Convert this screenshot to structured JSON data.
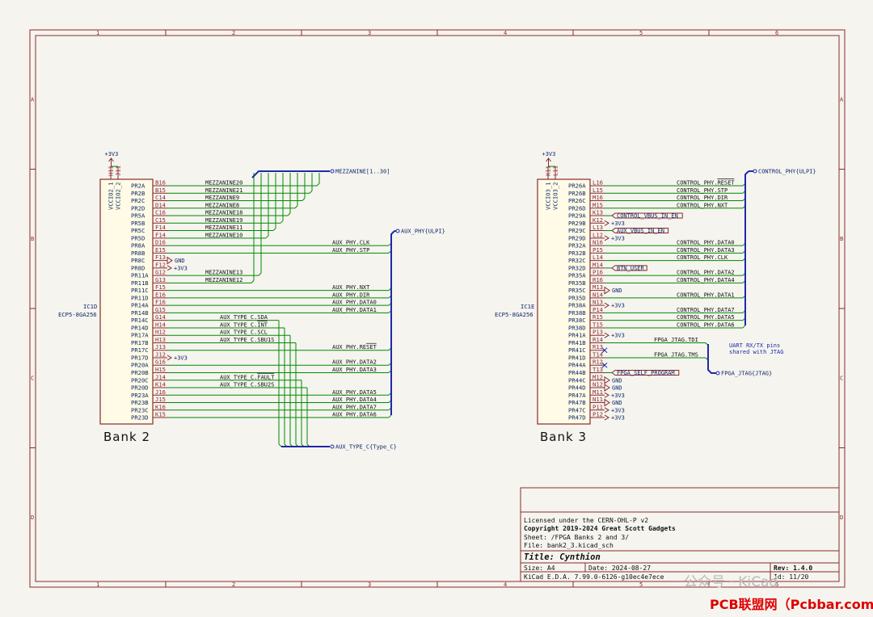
{
  "frame": {
    "columns": [
      "1",
      "2",
      "3",
      "4",
      "5",
      "6"
    ],
    "rows": [
      "A",
      "B",
      "C",
      "D"
    ]
  },
  "bank2": {
    "title": "Bank 2",
    "ref": "IC1D",
    "part": "ECP5-8GA256",
    "power_label": "+3V3",
    "top_pins": [
      {
        "num": "H11",
        "name": "VCCIO2_1"
      },
      {
        "num": "J11",
        "name": "VCCIO2_2"
      }
    ],
    "pins": [
      {
        "num": "B16",
        "name": "PR2A",
        "net": "MEZZANINE20",
        "kind": "mezz"
      },
      {
        "num": "B15",
        "name": "PR2B",
        "net": "MEZZANINE21",
        "kind": "mezz"
      },
      {
        "num": "C14",
        "name": "PR2C",
        "net": "MEZZANINE9",
        "kind": "mezz"
      },
      {
        "num": "D14",
        "name": "PR2D",
        "net": "MEZZANINE8",
        "kind": "mezz"
      },
      {
        "num": "C16",
        "name": "PR5A",
        "net": "MEZZANINE18",
        "kind": "mezz"
      },
      {
        "num": "C15",
        "name": "PR5B",
        "net": "MEZZANINE19",
        "kind": "mezz"
      },
      {
        "num": "F14",
        "name": "PR5C",
        "net": "MEZZANINE11",
        "kind": "mezz"
      },
      {
        "num": "F14",
        "name": "PR5D",
        "net": "MEZZANINE10",
        "kind": "mezz"
      },
      {
        "num": "D16",
        "name": "PR8A",
        "net": "AUX_PHY.CLK",
        "kind": "ulpi"
      },
      {
        "num": "E15",
        "name": "PR8B",
        "net": "AUX_PHY.STP",
        "kind": "ulpi"
      },
      {
        "num": "F13",
        "name": "PR8C",
        "net": "GND",
        "kind": "gnd"
      },
      {
        "num": "F12",
        "name": "PR8D",
        "net": "+3V3",
        "kind": "pwr"
      },
      {
        "num": "G12",
        "name": "PR11A",
        "net": "MEZZANINE13",
        "kind": "mezz"
      },
      {
        "num": "G13",
        "name": "PR11B",
        "net": "MEZZANINE12",
        "kind": "mezz"
      },
      {
        "num": "F15",
        "name": "PR11C",
        "net": "AUX_PHY.NXT",
        "kind": "ulpi"
      },
      {
        "num": "E16",
        "name": "PR11D",
        "net": "AUX_PHY.DIR",
        "kind": "ulpi"
      },
      {
        "num": "F16",
        "name": "PR14A",
        "net": "AUX_PHY.DATA0",
        "kind": "ulpi"
      },
      {
        "num": "G15",
        "name": "PR14B",
        "net": "AUX_PHY.DATA1",
        "kind": "ulpi"
      },
      {
        "num": "G14",
        "name": "PR14C",
        "net": "AUX_TYPE_C.SDA",
        "kind": "typec"
      },
      {
        "num": "H14",
        "name": "PR14D",
        "net": "AUX_TYPE_C.INT",
        "kind": "typec",
        "overline": true
      },
      {
        "num": "H12",
        "name": "PR17A",
        "net": "AUX_TYPE_C.SCL",
        "kind": "typec"
      },
      {
        "num": "H13",
        "name": "PR17B",
        "net": "AUX_TYPE_C.SBU1S",
        "kind": "typec"
      },
      {
        "num": "J13",
        "name": "PR17C",
        "net": "AUX_PHY.RESET",
        "kind": "ulpi",
        "overline": true
      },
      {
        "num": "J12",
        "name": "PR17D",
        "net": "+3V3",
        "kind": "pwr"
      },
      {
        "num": "G16",
        "name": "PR20A",
        "net": "AUX_PHY.DATA2",
        "kind": "ulpi"
      },
      {
        "num": "H15",
        "name": "PR20B",
        "net": "AUX_PHY.DATA3",
        "kind": "ulpi"
      },
      {
        "num": "J14",
        "name": "PR20C",
        "net": "AUX_TYPE_C.FAULT",
        "kind": "typec",
        "overline": true
      },
      {
        "num": "K14",
        "name": "PR20D",
        "net": "AUX_TYPE_C.SBU2S",
        "kind": "typec"
      },
      {
        "num": "J16",
        "name": "PR23A",
        "net": "AUX_PHY.DATA5",
        "kind": "ulpi"
      },
      {
        "num": "J15",
        "name": "PR23B",
        "net": "AUX_PHY.DATA4",
        "kind": "ulpi"
      },
      {
        "num": "K16",
        "name": "PR23C",
        "net": "AUX_PHY.DATA7",
        "kind": "ulpi"
      },
      {
        "num": "K15",
        "name": "PR23D",
        "net": "AUX_PHY.DATA6",
        "kind": "ulpi"
      }
    ],
    "bus_mezz": "MEZZANINE[1..30]",
    "bus_ulpi": "AUX_PHY{ULPI}",
    "bus_typec": "AUX_TYPE_C{Type_C}"
  },
  "bank3": {
    "title": "Bank 3",
    "ref": "IC1E",
    "part": "ECP5-8GA256",
    "power_label": "+3V3",
    "top_pins": [
      {
        "num": "K11",
        "name": "VCCIO3_1"
      },
      {
        "num": "L11",
        "name": "VCCIO3_2"
      }
    ],
    "pins": [
      {
        "num": "L16",
        "name": "PR26A",
        "net": "CONTROL_PHY.RESET",
        "kind": "ulpi",
        "overline": true
      },
      {
        "num": "L15",
        "name": "PR26B",
        "net": "CONTROL_PHY.STP",
        "kind": "ulpi"
      },
      {
        "num": "M16",
        "name": "PR26C",
        "net": "CONTROL_PHY.DIR",
        "kind": "ulpi"
      },
      {
        "num": "M15",
        "name": "PR26D",
        "net": "CONTROL_PHY.NXT",
        "kind": "ulpi"
      },
      {
        "num": "K13",
        "name": "PR29A",
        "net": "CONTROL_VBUS_IN_EN",
        "kind": "hlabel"
      },
      {
        "num": "K12",
        "name": "PR29B",
        "net": "+3V3",
        "kind": "pwr"
      },
      {
        "num": "L13",
        "name": "PR29C",
        "net": "AUX_VBUS_IN_EN",
        "kind": "hlabel"
      },
      {
        "num": "L12",
        "name": "PR29D",
        "net": "+3V3",
        "kind": "pwr"
      },
      {
        "num": "N16",
        "name": "PR32A",
        "net": "CONTROL_PHY.DATA0",
        "kind": "ulpi"
      },
      {
        "num": "P15",
        "name": "PR32B",
        "net": "CONTROL_PHY.DATA3",
        "kind": "ulpi"
      },
      {
        "num": "L14",
        "name": "PR32C",
        "net": "CONTROL_PHY.CLK",
        "kind": "ulpi"
      },
      {
        "num": "M14",
        "name": "PR32D",
        "net": "BTN_USER",
        "kind": "hlabel"
      },
      {
        "num": "P16",
        "name": "PR35A",
        "net": "CONTROL_PHY.DATA2",
        "kind": "ulpi"
      },
      {
        "num": "R16",
        "name": "PR35B",
        "net": "CONTROL_PHY.DATA4",
        "kind": "ulpi"
      },
      {
        "num": "M13",
        "name": "PR35C",
        "net": "GND",
        "kind": "gnd"
      },
      {
        "num": "N14",
        "name": "PR35D",
        "net": "CONTROL_PHY.DATA1",
        "kind": "ulpi"
      },
      {
        "num": "N13",
        "name": "PR38A",
        "net": "+3V3",
        "kind": "pwr"
      },
      {
        "num": "P14",
        "name": "PR38B",
        "net": "CONTROL_PHY.DATA7",
        "kind": "ulpi"
      },
      {
        "num": "R15",
        "name": "PR38C",
        "net": "CONTROL_PHY.DATA5",
        "kind": "ulpi"
      },
      {
        "num": "T15",
        "name": "PR38D",
        "net": "CONTROL_PHY.DATA6",
        "kind": "ulpi"
      },
      {
        "num": "P13",
        "name": "PR41A",
        "net": "+3V3",
        "kind": "pwr"
      },
      {
        "num": "R14",
        "name": "PR41B",
        "net": "FPGA_JTAG.TDI",
        "kind": "jtag"
      },
      {
        "num": "R13",
        "name": "PR41C",
        "net": "",
        "kind": "nc"
      },
      {
        "num": "T14",
        "name": "PR41D",
        "net": "FPGA_JTAG.TMS",
        "kind": "jtag"
      },
      {
        "num": "R12",
        "name": "PR44A",
        "net": "",
        "kind": "nc"
      },
      {
        "num": "T13",
        "name": "PR44B",
        "net": "FPGA_SELF_PROGRAM",
        "kind": "hlabel"
      },
      {
        "num": "M12",
        "name": "PR44C",
        "net": "GND",
        "kind": "gnd"
      },
      {
        "num": "N12",
        "name": "PR44D",
        "net": "GND",
        "kind": "gnd"
      },
      {
        "num": "M11",
        "name": "PR47A",
        "net": "+3V3",
        "kind": "pwr"
      },
      {
        "num": "N11",
        "name": "PR47B",
        "net": "GND",
        "kind": "gnd"
      },
      {
        "num": "P11",
        "name": "PR47C",
        "net": "+3V3",
        "kind": "pwr"
      },
      {
        "num": "P12",
        "name": "PR47D",
        "net": "+3V3",
        "kind": "pwr"
      }
    ],
    "bus_ulpi": "CONTROL_PHY{ULPI}",
    "bus_jtag": "FPGA_JTAG{JTAG}",
    "note": [
      "UART RX/TX pins",
      "shared with JTAG"
    ]
  },
  "title_block": {
    "license": "Licensed under the CERN-OHL-P v2",
    "copyright": "Copyright 2019-2024 Great Scott Gadgets",
    "sheet": "Sheet: /FPGA Banks 2 and 3/",
    "file": "File: bank2_3.kicad_sch",
    "title": "Title: Cynthion",
    "size": "Size: A4",
    "date": "Date: 2024-08-27",
    "rev": "Rev: 1.4.0",
    "tool": "KiCad E.D.A. 7.99.0-6126-g10ec4e7ece",
    "id": "Id: 11/20"
  },
  "watermark": {
    "wechat": "公众号 · KiCad",
    "site": "PCB联盟网（Pcbbar.com）"
  }
}
